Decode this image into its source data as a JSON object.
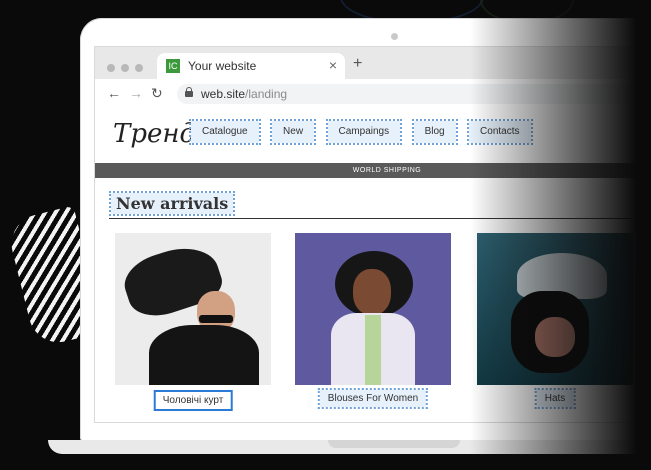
{
  "browser": {
    "tab_title": "Your website",
    "favicon_text": "IC",
    "tab_close": "×",
    "new_tab": "+",
    "url_domain": "web.site",
    "url_path": "/landing"
  },
  "site": {
    "logo_text": "Тренд",
    "menu": [
      "Catalogue",
      "New",
      "Campaings",
      "Blog",
      "Contacts"
    ],
    "banner": "WORLD SHIPPING",
    "heading": "New arrivals",
    "products": [
      {
        "label": "Чоловічі курт",
        "editing": true
      },
      {
        "label": "Blouses For Women",
        "editing": false
      },
      {
        "label": "Hats",
        "editing": false
      }
    ]
  },
  "colors": {
    "accent": "#2b7bd6",
    "highlight": "#e6f1fb",
    "banner_bg": "#5a5a5a",
    "background": "#0a0a0a"
  }
}
